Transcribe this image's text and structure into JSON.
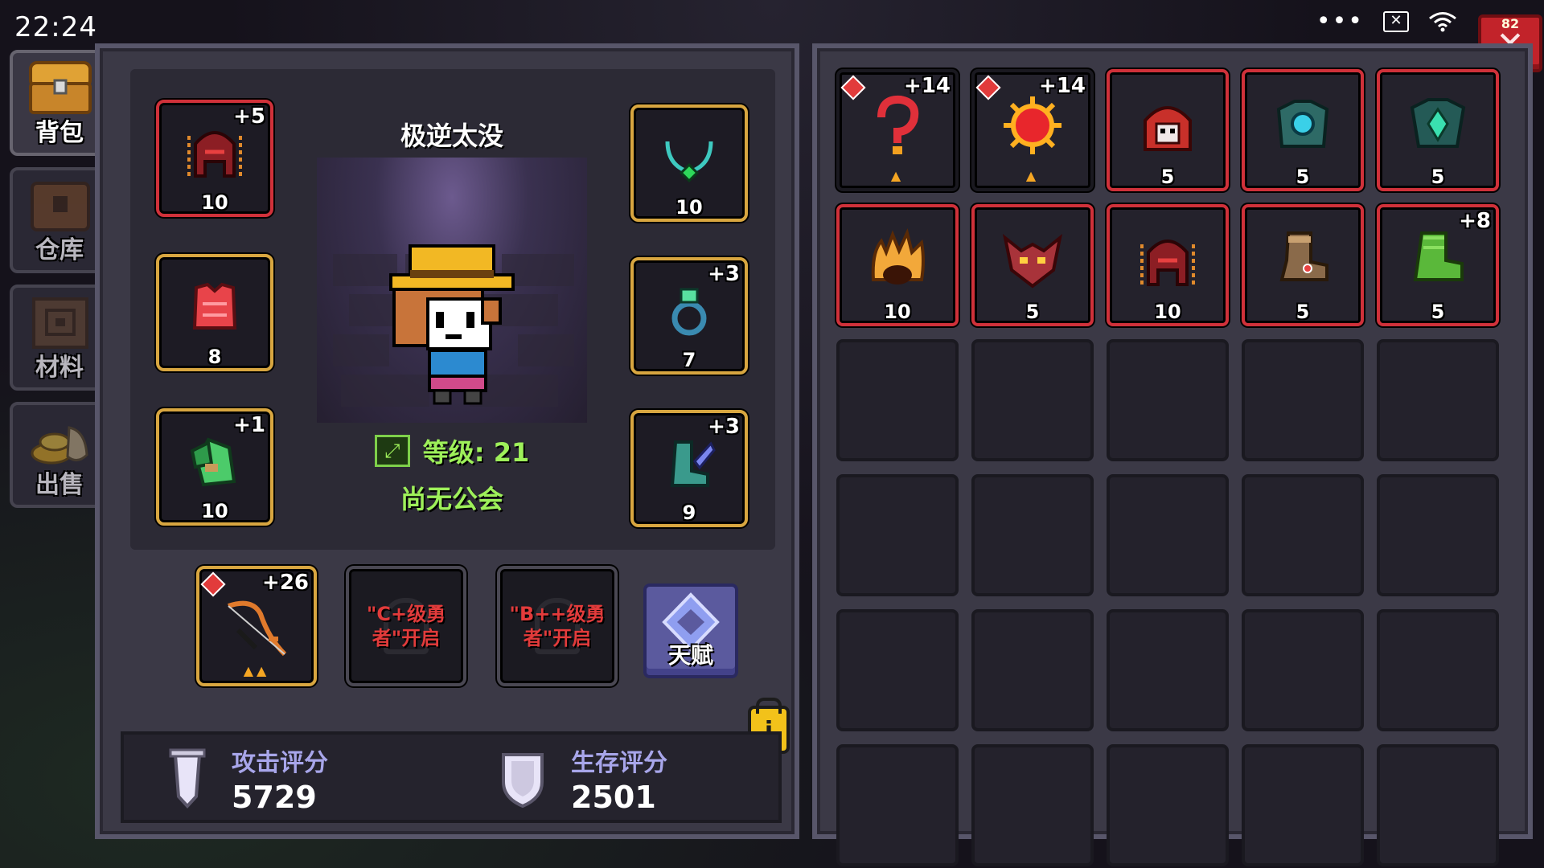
{
  "status_bar": {
    "time": "22:24",
    "battery": "82"
  },
  "nav": [
    {
      "label": "背包",
      "icon": "chest-icon",
      "active": true
    },
    {
      "label": "仓库",
      "icon": "warehouse-icon",
      "active": false
    },
    {
      "label": "材料",
      "icon": "materials-icon",
      "active": false
    },
    {
      "label": "出售",
      "icon": "sell-gold-icon",
      "active": false
    }
  ],
  "hero": {
    "name": "极逆太没",
    "level_label": "等级: 21",
    "guild": "尚无公会"
  },
  "equipment": {
    "helmet": {
      "level": "10",
      "plus": "+5"
    },
    "armor": {
      "level": "8"
    },
    "gloves": {
      "level": "10",
      "plus": "+1"
    },
    "necklace": {
      "level": "10"
    },
    "ring": {
      "level": "7",
      "plus": "+3"
    },
    "boots": {
      "level": "9",
      "plus": "+3"
    }
  },
  "weapons": {
    "bow": {
      "plus": "+26"
    },
    "locked_slot_1": "\"C+级勇者\"开启",
    "locked_slot_2": "\"B++级勇者\"开启",
    "talent_label": "天赋"
  },
  "scores": {
    "attack_label": "攻击评分",
    "attack_value": "5729",
    "survival_label": "生存评分",
    "survival_value": "2501"
  },
  "inventory": [
    {
      "name": "question-hook-icon",
      "plus": "+14",
      "gem": true,
      "frame": "gold"
    },
    {
      "name": "sun-orb-icon",
      "plus": "+14",
      "gem": true,
      "frame": "gold"
    },
    {
      "name": "skull-hood-icon",
      "level": "5",
      "frame": "red"
    },
    {
      "name": "teal-armor-icon",
      "level": "5",
      "frame": "red"
    },
    {
      "name": "crystal-armor-icon",
      "level": "5",
      "frame": "red"
    },
    {
      "name": "fire-hair-icon",
      "level": "10",
      "frame": "red"
    },
    {
      "name": "demon-mask-icon",
      "level": "5",
      "frame": "red"
    },
    {
      "name": "chain-helmet-icon",
      "level": "10",
      "frame": "red"
    },
    {
      "name": "leather-boot-icon",
      "level": "5",
      "frame": "red"
    },
    {
      "name": "moss-boot-icon",
      "level": "5",
      "plus": "+8",
      "frame": "red"
    }
  ]
}
